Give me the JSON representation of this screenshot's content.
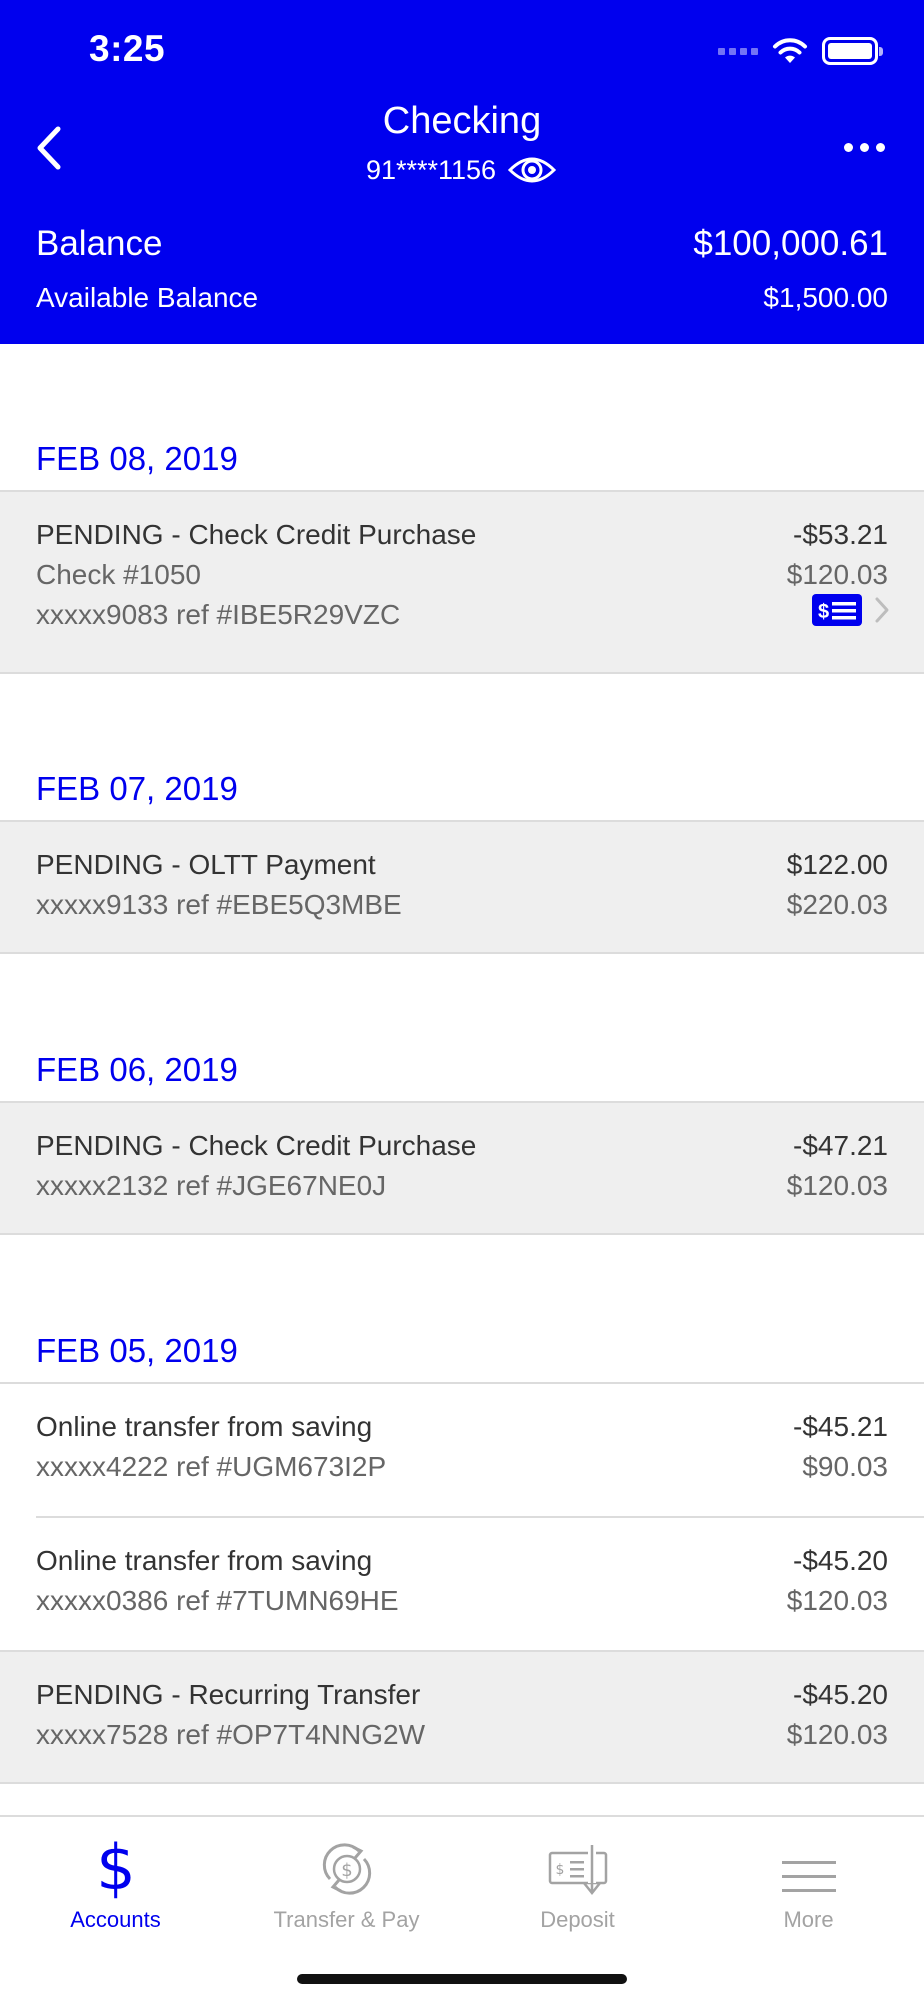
{
  "status": {
    "time": "3:25"
  },
  "header": {
    "title": "Checking",
    "account_masked": "91****1156",
    "balance_label": "Balance",
    "balance_value": "$100,000.61",
    "available_label": "Available Balance",
    "available_value": "$1,500.00",
    "color": "#0000ee"
  },
  "sections": [
    {
      "date": "FEB 08, 2019",
      "transactions": [
        {
          "title": "PENDING - Check Credit Purchase",
          "line2": "Check #1050",
          "line3": "xxxxx9083 ref #IBE5R29VZC",
          "amount": "-$53.21",
          "balance": "$120.03",
          "pending": true,
          "has_check_image": true
        }
      ]
    },
    {
      "date": "FEB 07, 2019",
      "transactions": [
        {
          "title": "PENDING - OLTT Payment",
          "line2": "xxxxx9133 ref #EBE5Q3MBE",
          "amount": "$122.00",
          "balance": "$220.03",
          "pending": true
        }
      ]
    },
    {
      "date": "FEB 06, 2019",
      "transactions": [
        {
          "title": "PENDING - Check Credit Purchase",
          "line2": "xxxxx2132 ref #JGE67NE0J",
          "amount": "-$47.21",
          "balance": "$120.03",
          "pending": true
        }
      ]
    },
    {
      "date": "FEB 05, 2019",
      "transactions": [
        {
          "title": "Online transfer from saving",
          "line2": "xxxxx4222 ref #UGM673I2P",
          "amount": "-$45.21",
          "balance": "$90.03",
          "pending": false
        },
        {
          "title": "Online transfer from saving",
          "line2": "xxxxx0386 ref #7TUMN69HE",
          "amount": "-$45.20",
          "balance": "$120.03",
          "pending": false
        },
        {
          "title": "PENDING - Recurring Transfer",
          "line2": "xxxxx7528 ref #OP7T4NNG2W",
          "amount": "-$45.20",
          "balance": "$120.03",
          "pending": true
        }
      ]
    }
  ],
  "tabbar": {
    "tabs": [
      {
        "label": "Accounts",
        "icon": "dollar-icon",
        "active": true
      },
      {
        "label": "Transfer & Pay",
        "icon": "transfer-pay-icon",
        "active": false
      },
      {
        "label": "Deposit",
        "icon": "check-deposit-icon",
        "active": false
      },
      {
        "label": "More",
        "icon": "hamburger-menu-icon",
        "active": false
      }
    ],
    "active_color": "#0000ee",
    "inactive_color": "#a3a3a3"
  }
}
